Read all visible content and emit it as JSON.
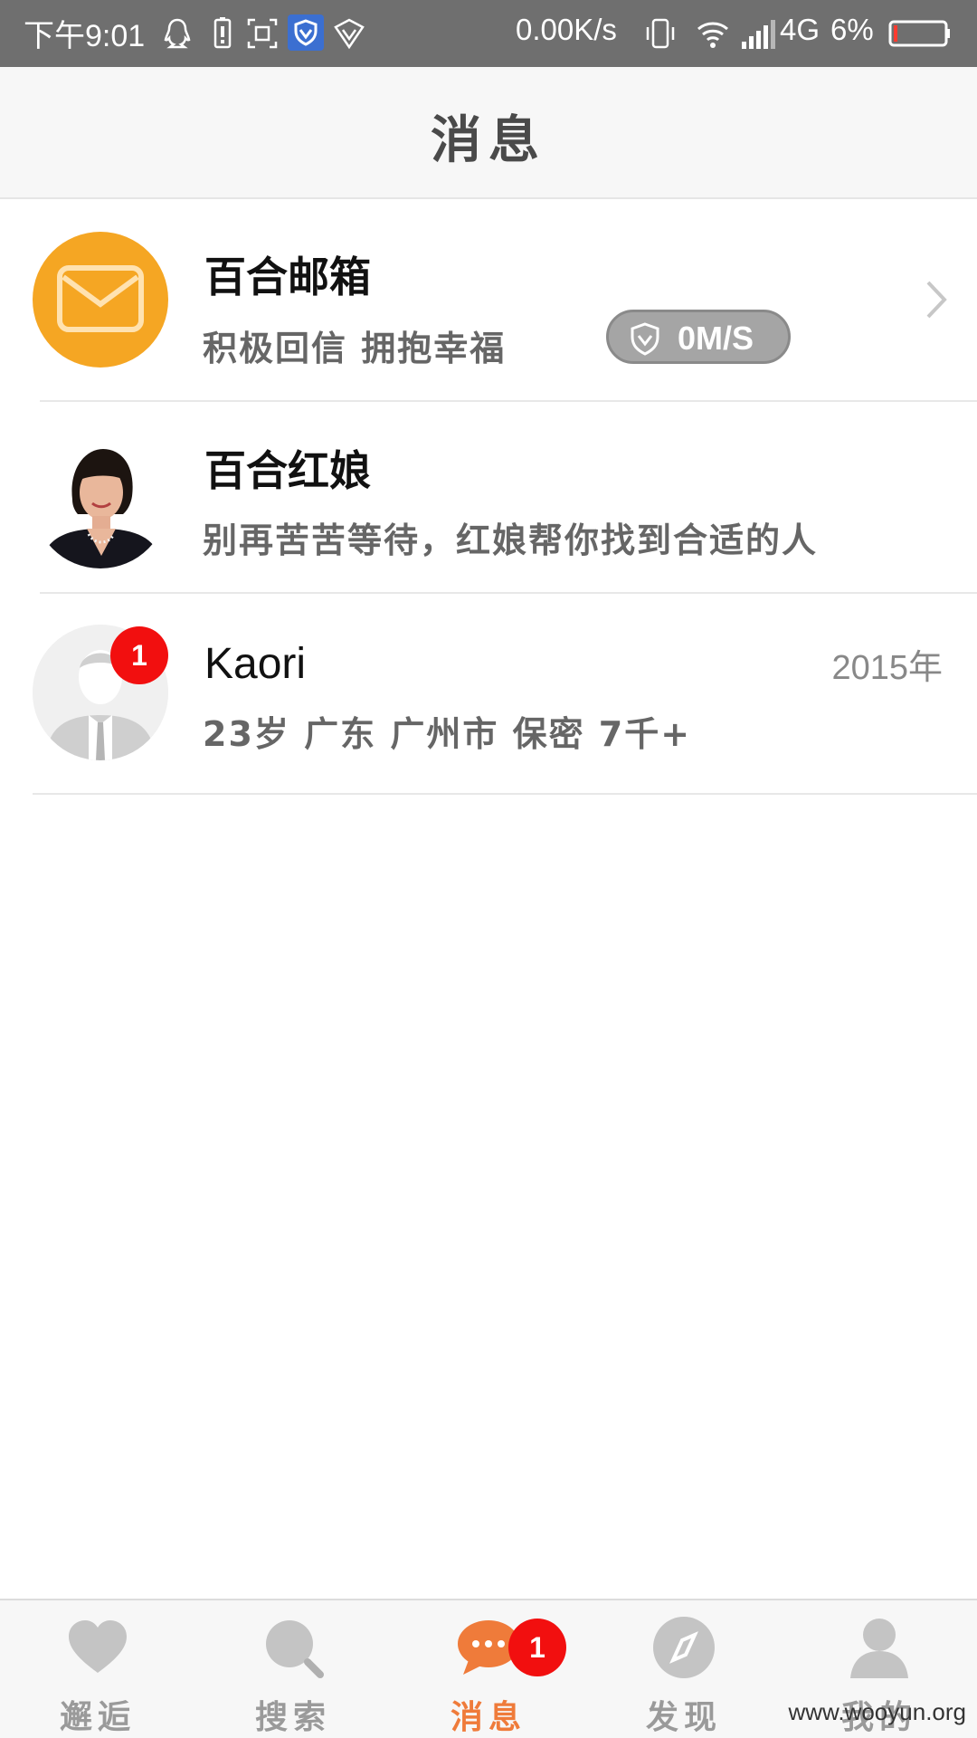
{
  "status_bar": {
    "time": "下午9:01",
    "net_speed": "0.00K/s",
    "network": "4G",
    "battery": "6%"
  },
  "header": {
    "title": "消息"
  },
  "messages": [
    {
      "name": "百合邮箱",
      "subtitle": "积极回信 拥抱幸福",
      "speed_badge": "0M/S",
      "avatar_icon": "envelope-icon",
      "accent": "#f5a623"
    },
    {
      "name": "百合红娘",
      "subtitle": "别再苦苦等待，红娘帮你找到合适的人",
      "avatar_icon": "matchmaker-photo"
    },
    {
      "name": "Kaori",
      "subtitle": "23岁  广东 广州市  保密  7千+",
      "date": "2015年",
      "unread": "1",
      "avatar_icon": "default-user-icon"
    }
  ],
  "tabs": [
    {
      "label": "邂逅",
      "icon": "heart-icon"
    },
    {
      "label": "搜索",
      "icon": "search-icon"
    },
    {
      "label": "消息",
      "icon": "chat-icon",
      "badge": "1",
      "active": true
    },
    {
      "label": "发现",
      "icon": "compass-icon"
    },
    {
      "label": "我的",
      "icon": "profile-icon"
    }
  ],
  "colors": {
    "active_tab": "#ef7b3a",
    "badge": "#f20f0f",
    "mail_avatar": "#f5a623"
  },
  "watermark": "www.wooyun.org"
}
